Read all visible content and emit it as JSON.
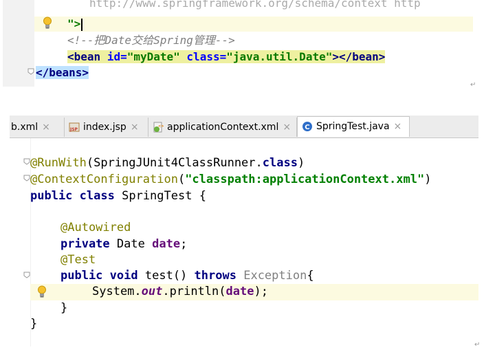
{
  "xml_editor": {
    "line_url": "http://www.springframework.org/schema/context http",
    "line_quote": "\">",
    "line_comment": "<!--把Date交给Spring管理-->",
    "bean_tag_open": "<bean",
    "bean_id_attr": "id=",
    "bean_id_value": "\"myDate\"",
    "bean_class_attr": "class=",
    "bean_class_value": "\"java.util.Date\"",
    "bean_tag_close": "></bean>",
    "beans_close": "</beans>"
  },
  "tabs": [
    {
      "label": "b.xml",
      "icon": "xml-file-icon"
    },
    {
      "label": "index.jsp",
      "icon": "jsp-file-icon"
    },
    {
      "label": "applicationContext.xml",
      "icon": "spring-xml-file-icon"
    },
    {
      "label": "SpringTest.java",
      "icon": "java-class-icon",
      "active": true
    }
  ],
  "tab_close": "×",
  "java_editor": {
    "ann_runwith": "@RunWith",
    "runwith_args_open": "(SpringJUnit4ClassRunner.",
    "kw_class": "class",
    "runwith_args_close": ")",
    "ann_context": "@ContextConfiguration",
    "paren_open": "(",
    "context_value": "\"classpath:applicationContext.xml\"",
    "paren_close": ")",
    "kw_public": "public",
    "kw_class2": "class",
    "class_name": "SpringTest {",
    "ann_autowired": "@Autowired",
    "kw_private": "private",
    "type_date": "Date",
    "field_date": "date",
    "semicolon": ";",
    "ann_test": "@Test",
    "kw_public2": "public",
    "kw_void": "void",
    "method_sig": "test()",
    "kw_throws": "throws",
    "exception": "Exception",
    "brace_open": "{",
    "sys_prefix": "System.",
    "static_out": "out",
    "println": ".println(",
    "arg_date": "date",
    "println_end": ");",
    "brace_close_inner": "}",
    "brace_close_outer": "}"
  },
  "return_mark": "↵"
}
